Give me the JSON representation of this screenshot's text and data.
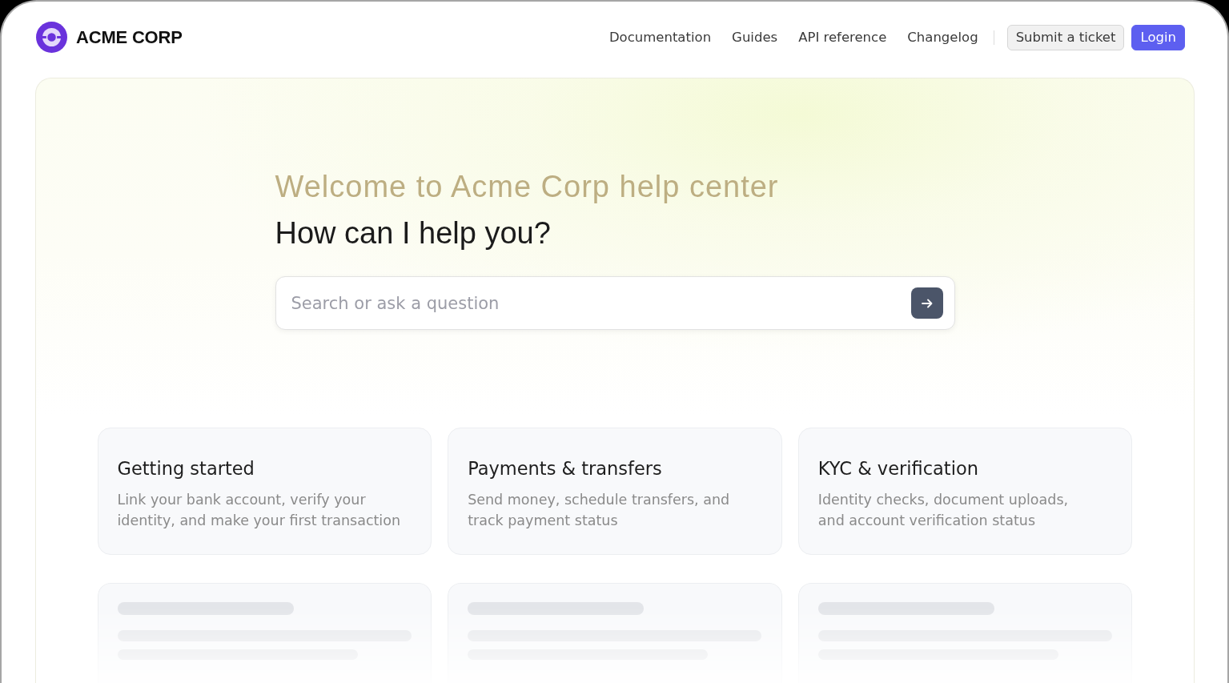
{
  "header": {
    "brand": "ACME CORP",
    "nav_links": [
      "Documentation",
      "Guides",
      "API reference",
      "Changelog"
    ],
    "buttons": [
      {
        "label": "Submit a ticket",
        "kind": "secondary"
      },
      {
        "label": "Login",
        "kind": "primary"
      }
    ]
  },
  "hero": {
    "title": "Welcome to Acme Corp help center",
    "subtitle": "How can I help you?",
    "search": {
      "placeholder": "Search or ask a question"
    }
  },
  "cards": [
    {
      "kind": "topic",
      "title": "Getting started",
      "description": "Link your bank account, verify your\nidentity, and make your first transaction"
    },
    {
      "kind": "topic",
      "title": "Payments & transfers",
      "description": "Send money, schedule transfers, and\ntrack payment status"
    },
    {
      "kind": "topic",
      "title": "KYC & verification",
      "description": "Identity checks, document uploads,\nand account verification status"
    },
    {
      "kind": "skeleton"
    },
    {
      "kind": "skeleton"
    },
    {
      "kind": "skeleton"
    }
  ]
}
